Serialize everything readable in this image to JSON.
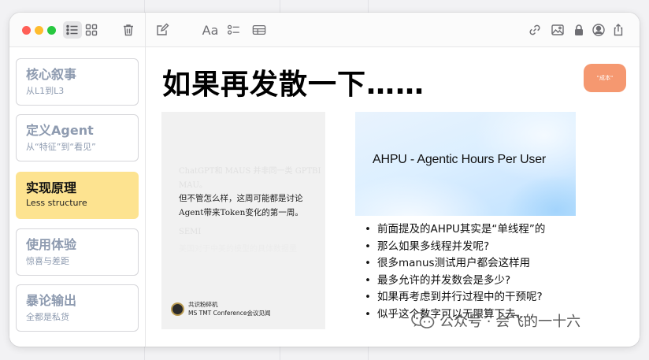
{
  "toolbar": {
    "traffic_colors": [
      "#ff5f57",
      "#febc2e",
      "#28c840"
    ],
    "icons": [
      "list-view-icon",
      "grid-view-icon",
      "trash-icon",
      "compose-icon",
      "text-format-icon",
      "checklist-icon",
      "table-icon",
      "link-icon",
      "image-icon",
      "lock-icon",
      "collaborate-icon",
      "share-icon"
    ],
    "format_label": "Aa"
  },
  "sidebar": {
    "items": [
      {
        "title": "核心叙事",
        "subtitle": "从L1到L3",
        "active": false
      },
      {
        "title": "定义Agent",
        "subtitle": "从“特征”到“看见”",
        "active": false
      },
      {
        "title": "实现原理",
        "subtitle": "Less structure",
        "active": true
      },
      {
        "title": "使用体验",
        "subtitle": "惊喜与差距",
        "active": false
      },
      {
        "title": "暴论输出",
        "subtitle": "全都是私货",
        "active": false
      }
    ],
    "active_color": "#fde390"
  },
  "main": {
    "title": "如果再发散一下……",
    "badge": "\"成本\"",
    "badge_color": "#f59870",
    "left_panel": {
      "faint_top_1": "ChatGPT和 MAUS 并非同一类 GPTBI",
      "faint_top_2": "MAU。",
      "line_1": "但不管怎么样，这周可能都是讨论",
      "line_2": "Agent带来Token变化的第一周。",
      "faint_bottom_1": "SEMI",
      "faint_bottom_2": "美国对于中美的模型的具体数据量",
      "footer_name": "共识粉碎机",
      "footer_sub": "MS TMT Conference会议见闻"
    },
    "hero_title": "AHPU - Agentic Hours Per User",
    "bullets": [
      "前面提及的AHPU其实是“单线程”的",
      "那么如果多线程并发呢?",
      "很多manus测试用户都会这样用",
      "最多允许的并发数会是多少?",
      "如果再考虑到并行过程中的干预呢?",
      "似乎这个数字可以无限算下去……"
    ]
  },
  "watermark": {
    "text": "公众号 · 会飞的一十六",
    "icon": "wechat-icon"
  }
}
